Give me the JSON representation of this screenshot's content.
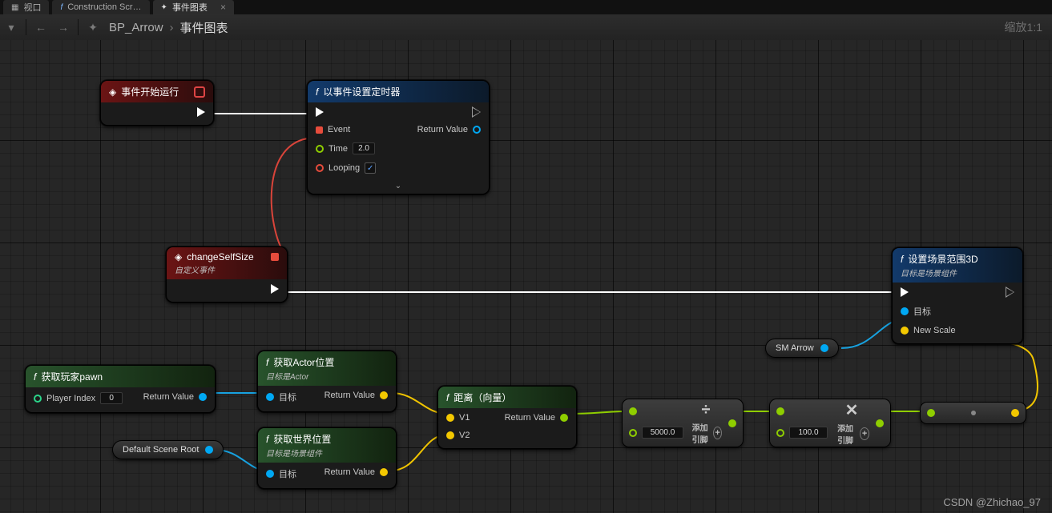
{
  "tabs": {
    "viewport": "视口",
    "construction": "Construction Scr…",
    "eventgraph": "事件图表"
  },
  "breadcrumb": {
    "asset": "BP_Arrow",
    "graph": "事件图表"
  },
  "zoom": "缩放1:1",
  "nodes": {
    "beginPlay": {
      "title": "事件开始运行"
    },
    "setTimer": {
      "title": "以事件设置定时器",
      "event": "Event",
      "time": "Time",
      "timeVal": "2.0",
      "looping": "Looping",
      "return": "Return Value"
    },
    "changeSelf": {
      "title": "changeSelfSize",
      "sub": "自定义事件"
    },
    "getPawn": {
      "title": "获取玩家pawn",
      "playerIndex": "Player Index",
      "playerIndexVal": "0",
      "return": "Return Value"
    },
    "getActorLoc": {
      "title": "获取Actor位置",
      "sub": "目标是Actor",
      "target": "目标",
      "return": "Return Value"
    },
    "getWorldLoc": {
      "title": "获取世界位置",
      "sub": "目标是场景组件",
      "target": "目标",
      "return": "Return Value"
    },
    "distance": {
      "title": "距离（向量）",
      "v1": "V1",
      "v2": "V2",
      "return": "Return Value"
    },
    "divide": {
      "valA": "5000.0",
      "addPin": "添加引脚"
    },
    "divide2": {
      "valA": "100.0",
      "addPin": "添加引脚"
    },
    "setScale": {
      "title": "设置场景范围3D",
      "sub": "目标是场景组件",
      "target": "目标",
      "newScale": "New Scale"
    },
    "smArrow": {
      "label": "SM Arrow"
    },
    "defaultRoot": {
      "label": "Default Scene Root"
    }
  },
  "watermark": "CSDN @Zhichao_97"
}
